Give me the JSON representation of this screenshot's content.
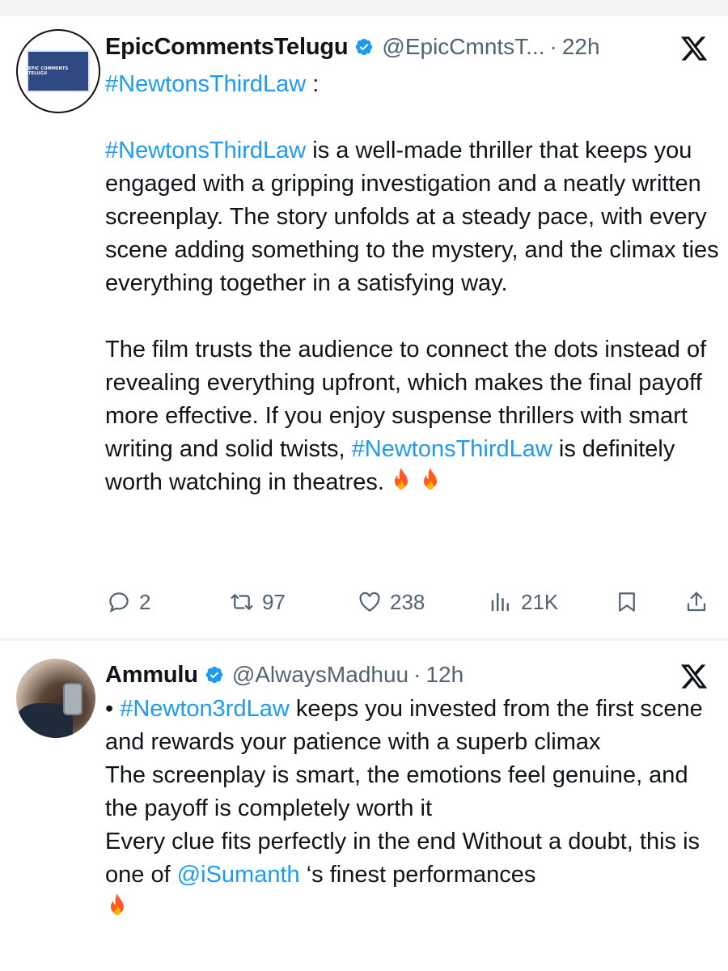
{
  "tweets": [
    {
      "display_name": "EpicCommentsTelugu",
      "handle": "@EpicCmntsT...",
      "dot": "·",
      "time": "22h",
      "avatar_text": "EPIC COMMENTS TELUGU",
      "line1_tag": "#NewtonsThirdLaw",
      "line1_suffix": " :",
      "p1_tag": "#NewtonsThirdLaw",
      "p1_text": " is a well-made thriller that keeps you engaged with a gripping investigation and a neatly written screenplay. The story unfolds at a steady pace, with every scene adding something to the mystery, and the climax ties everything together in a satisfying way.",
      "p2_before": "The film trusts the audience to connect the dots instead of revealing everything upfront, which makes the final payoff more effective. If you enjoy suspense thrillers with smart writing and solid twists, ",
      "p2_tag": "#NewtonsThirdLaw",
      "p2_after": " is definitely worth watching in theatres.",
      "actions": {
        "replies": "2",
        "reposts": "97",
        "likes": "238",
        "views": "21K"
      }
    },
    {
      "display_name": "Ammulu",
      "handle": "@AlwaysMadhuu",
      "dot": "·",
      "time": "12h",
      "bullet": "• ",
      "tag": "#Newton3rdLaw",
      "l1_rest": " keeps you invested from the first scene and rewards your patience with a superb climax",
      "l2": "The screenplay is smart, the emotions feel genuine, and the payoff is completely worth it",
      "l3_before": "Every clue fits perfectly in the end Without a doubt, this is one of ",
      "mention": "@iSumanth",
      "l3_after": " ‘s  finest performances"
    }
  ],
  "colors": {
    "link": "#1d9bf0",
    "secondary": "#536471",
    "text": "#0f1419",
    "verified": "#1d9bf0",
    "fire": "#ff5a1f"
  },
  "icons": [
    "verified-badge-icon",
    "x-logo-icon",
    "reply-icon",
    "repost-icon",
    "like-icon",
    "views-icon",
    "bookmark-icon",
    "share-icon",
    "fire-emoji-icon"
  ]
}
